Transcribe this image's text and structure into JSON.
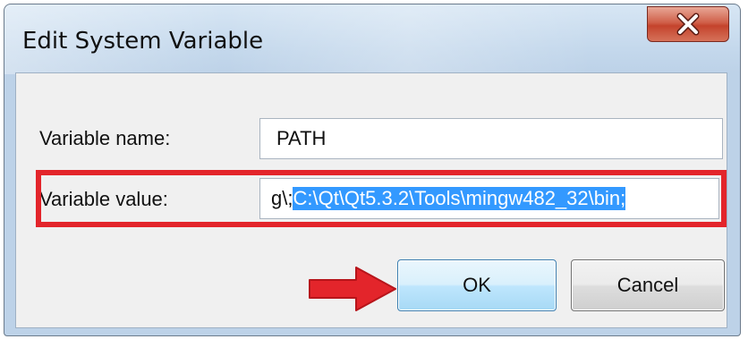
{
  "window": {
    "title": "Edit System Variable",
    "close_icon": "close-icon"
  },
  "form": {
    "name_label": "Variable name:",
    "name_value": "PATH",
    "value_label": "Variable value:",
    "value_prefix": "g\\;",
    "value_selected": "C:\\Qt\\Qt5.3.2\\Tools\\mingw482_32\\bin;"
  },
  "buttons": {
    "ok_label": "OK",
    "cancel_label": "Cancel"
  },
  "annotations": {
    "highlight_color": "#e3252b",
    "arrow_icon": "arrow-right-icon",
    "arrow_color": "#e3252b"
  },
  "colors": {
    "selection": "#3399ff",
    "close_button": "#c4432c"
  }
}
